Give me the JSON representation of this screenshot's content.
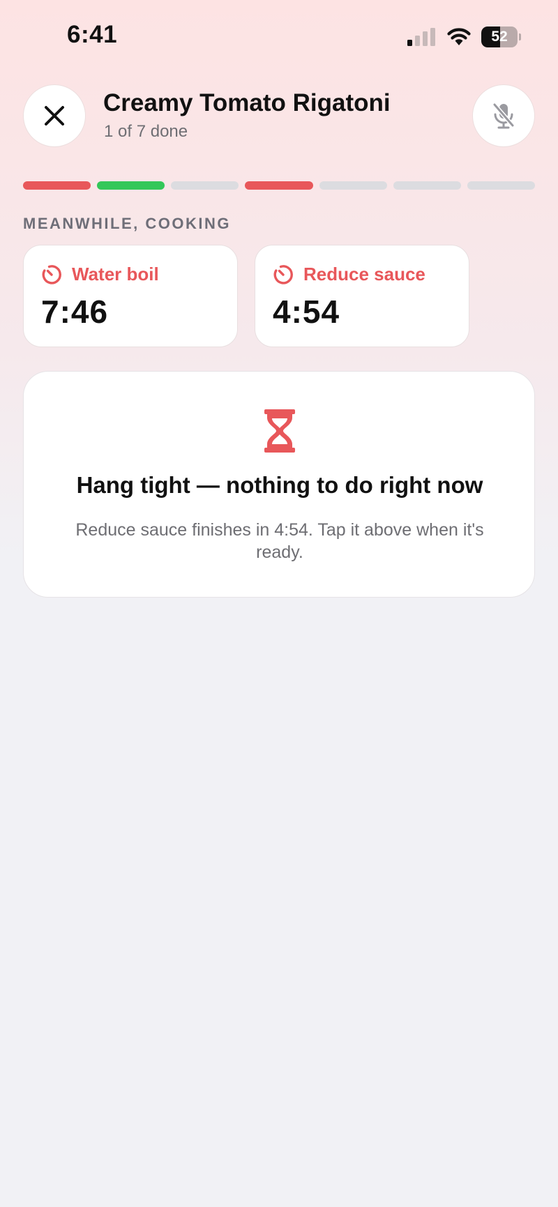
{
  "status_bar": {
    "time": "6:41",
    "battery_level": "52",
    "battery_fraction": 0.52,
    "signal_bars_active": 1,
    "signal_bars_total": 4,
    "icons": [
      "signal-icon",
      "wifi-icon",
      "battery-icon"
    ]
  },
  "header": {
    "title": "Creamy Tomato Rigatoni",
    "subtitle": "1 of 7 done",
    "close_icon": "close-icon",
    "mic_icon": "mic-off-icon"
  },
  "progress": {
    "steps": [
      {
        "state": "active",
        "color": "#e8575a"
      },
      {
        "state": "done",
        "color": "#34c759"
      },
      {
        "state": "pending",
        "color": "#dcdce0"
      },
      {
        "state": "active",
        "color": "#e8575a"
      },
      {
        "state": "pending",
        "color": "#dcdce0"
      },
      {
        "state": "pending",
        "color": "#dcdce0"
      },
      {
        "state": "pending",
        "color": "#dcdce0"
      }
    ]
  },
  "meanwhile": {
    "label": "MEANWHILE, COOKING",
    "timers": [
      {
        "label": "Water boil",
        "value": "7:46",
        "icon": "timer-icon"
      },
      {
        "label": "Reduce sauce",
        "value": "4:54",
        "icon": "timer-icon"
      }
    ]
  },
  "wait_card": {
    "icon": "hourglass-icon",
    "title": "Hang tight — nothing to do right now",
    "message": "Reduce sauce finishes in 4:54. Tap it above when it's ready."
  },
  "colors": {
    "accent": "#e8575a",
    "done": "#34c759",
    "pending": "#dcdce0"
  }
}
